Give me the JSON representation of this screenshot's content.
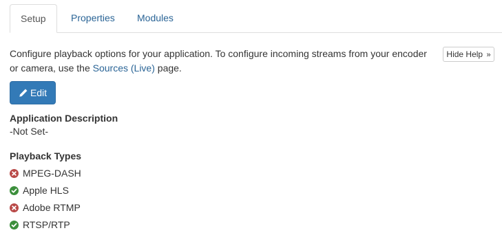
{
  "tabs": [
    {
      "label": "Setup",
      "active": true
    },
    {
      "label": "Properties",
      "active": false
    },
    {
      "label": "Modules",
      "active": false
    }
  ],
  "help": {
    "text_before": "Configure playback options for your application. To configure incoming streams from your encoder or camera, use the ",
    "link_text": "Sources (Live)",
    "text_after": " page.",
    "hide_label": "Hide Help",
    "hide_chevron": "»"
  },
  "edit_button": {
    "label": "Edit",
    "icon": "pencil-icon"
  },
  "description": {
    "title": "Application Description",
    "value": "-Not Set-"
  },
  "playback_types": {
    "title": "Playback Types",
    "items": [
      {
        "label": "MPEG-DASH",
        "enabled": false,
        "icon": "x-circle-icon"
      },
      {
        "label": "Apple HLS",
        "enabled": true,
        "icon": "check-circle-icon"
      },
      {
        "label": "Adobe RTMP",
        "enabled": false,
        "icon": "x-circle-icon"
      },
      {
        "label": "RTSP/RTP",
        "enabled": true,
        "icon": "check-circle-icon"
      }
    ]
  },
  "colors": {
    "link": "#2a6496",
    "primary_button": "#337ab7",
    "disabled_status": "#b94a48",
    "enabled_status": "#3c8f3c"
  }
}
